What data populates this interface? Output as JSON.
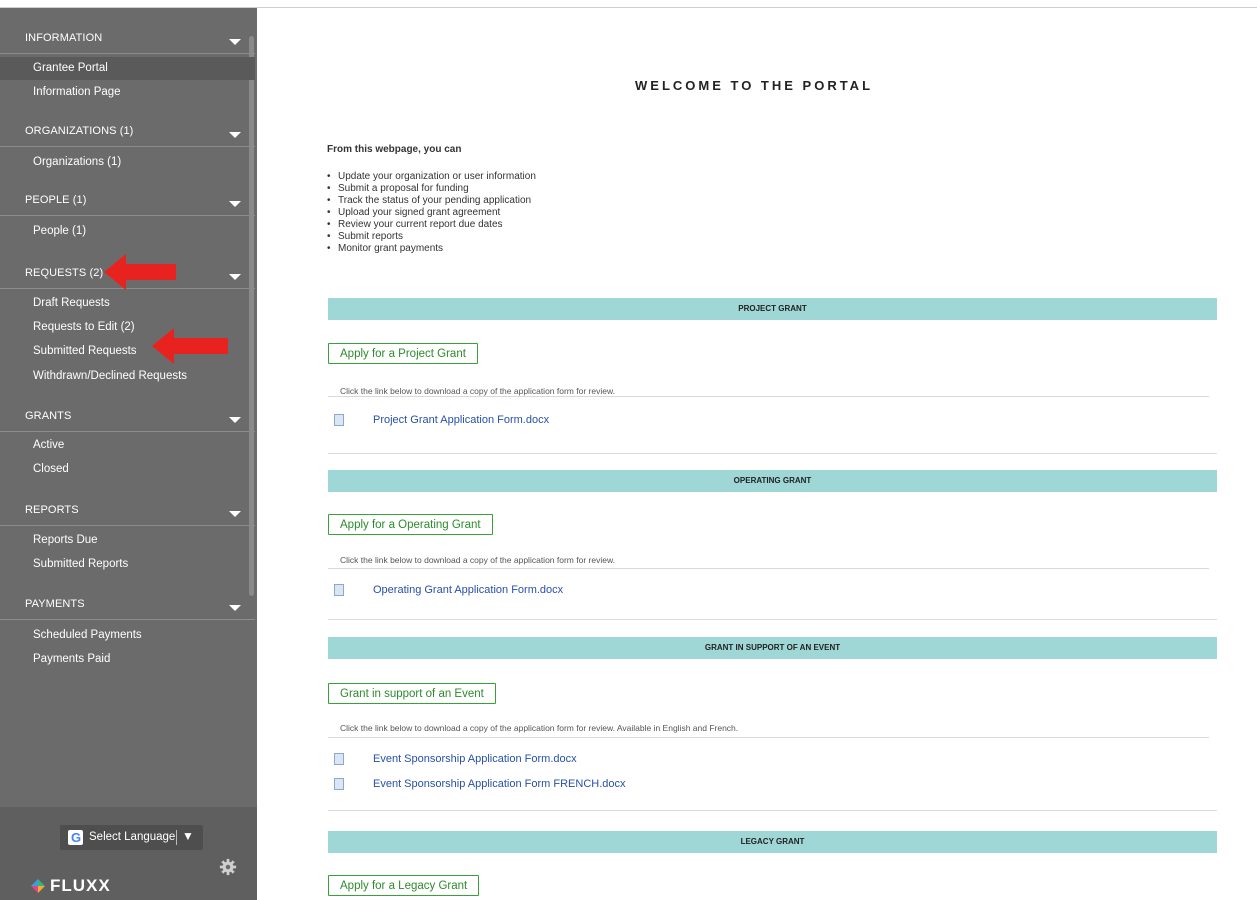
{
  "sidebar": {
    "sections": [
      {
        "title": "INFORMATION",
        "items": [
          "Grantee Portal",
          "Information Page"
        ]
      },
      {
        "title": "ORGANIZATIONS (1)",
        "items": [
          "Organizations  (1)"
        ]
      },
      {
        "title": "PEOPLE (1)",
        "items": [
          "People  (1)"
        ]
      },
      {
        "title": "REQUESTS (2)",
        "items": [
          "Draft Requests",
          "Requests to Edit  (2)",
          "Submitted Requests",
          "Withdrawn/Declined Requests"
        ]
      },
      {
        "title": "GRANTS",
        "items": [
          "Active",
          "Closed"
        ]
      },
      {
        "title": "REPORTS",
        "items": [
          "Reports Due",
          "Submitted Reports"
        ]
      },
      {
        "title": "PAYMENTS",
        "items": [
          "Scheduled Payments",
          "Payments Paid"
        ]
      }
    ],
    "language_label": "Select Language",
    "language_caret": "▼",
    "logo_text": "FLUXX",
    "colors": {
      "background": "#6b6b6b",
      "arrow": "#e8231f"
    }
  },
  "main": {
    "title": "WELCOME TO THE PORTAL",
    "intro": "From this webpage, you can",
    "bullets": [
      "Update your organization or user information",
      "Submit a proposal for funding",
      "Track the status of your pending application",
      "Upload your signed grant agreement",
      "Review your current report due dates",
      "Submit reports",
      "Monitor grant payments"
    ],
    "grants": [
      {
        "band": "PROJECT GRANT",
        "button": "Apply for a Project Grant",
        "note": "Click the link below to download a copy of the application form for review.",
        "files": [
          "Project Grant Application Form.docx"
        ]
      },
      {
        "band": "OPERATING GRANT",
        "button": "Apply for a Operating Grant",
        "note": "Click the link below to download a copy of the application form for review.",
        "files": [
          "Operating Grant Application Form.docx"
        ]
      },
      {
        "band": "GRANT IN SUPPORT OF AN EVENT",
        "button": "Grant in support of an Event",
        "note": "Click the link below to download a copy of the application form for review. Available in English and French.",
        "files": [
          "Event Sponsorship Application Form.docx",
          "Event Sponsorship Application Form FRENCH.docx"
        ]
      },
      {
        "band": "LEGACY GRANT",
        "button": "Apply for a Legacy Grant",
        "note": "",
        "files": []
      }
    ],
    "colors": {
      "band": "#9fd6d6",
      "button_border": "#3aa13a",
      "link": "#2750a8"
    }
  }
}
